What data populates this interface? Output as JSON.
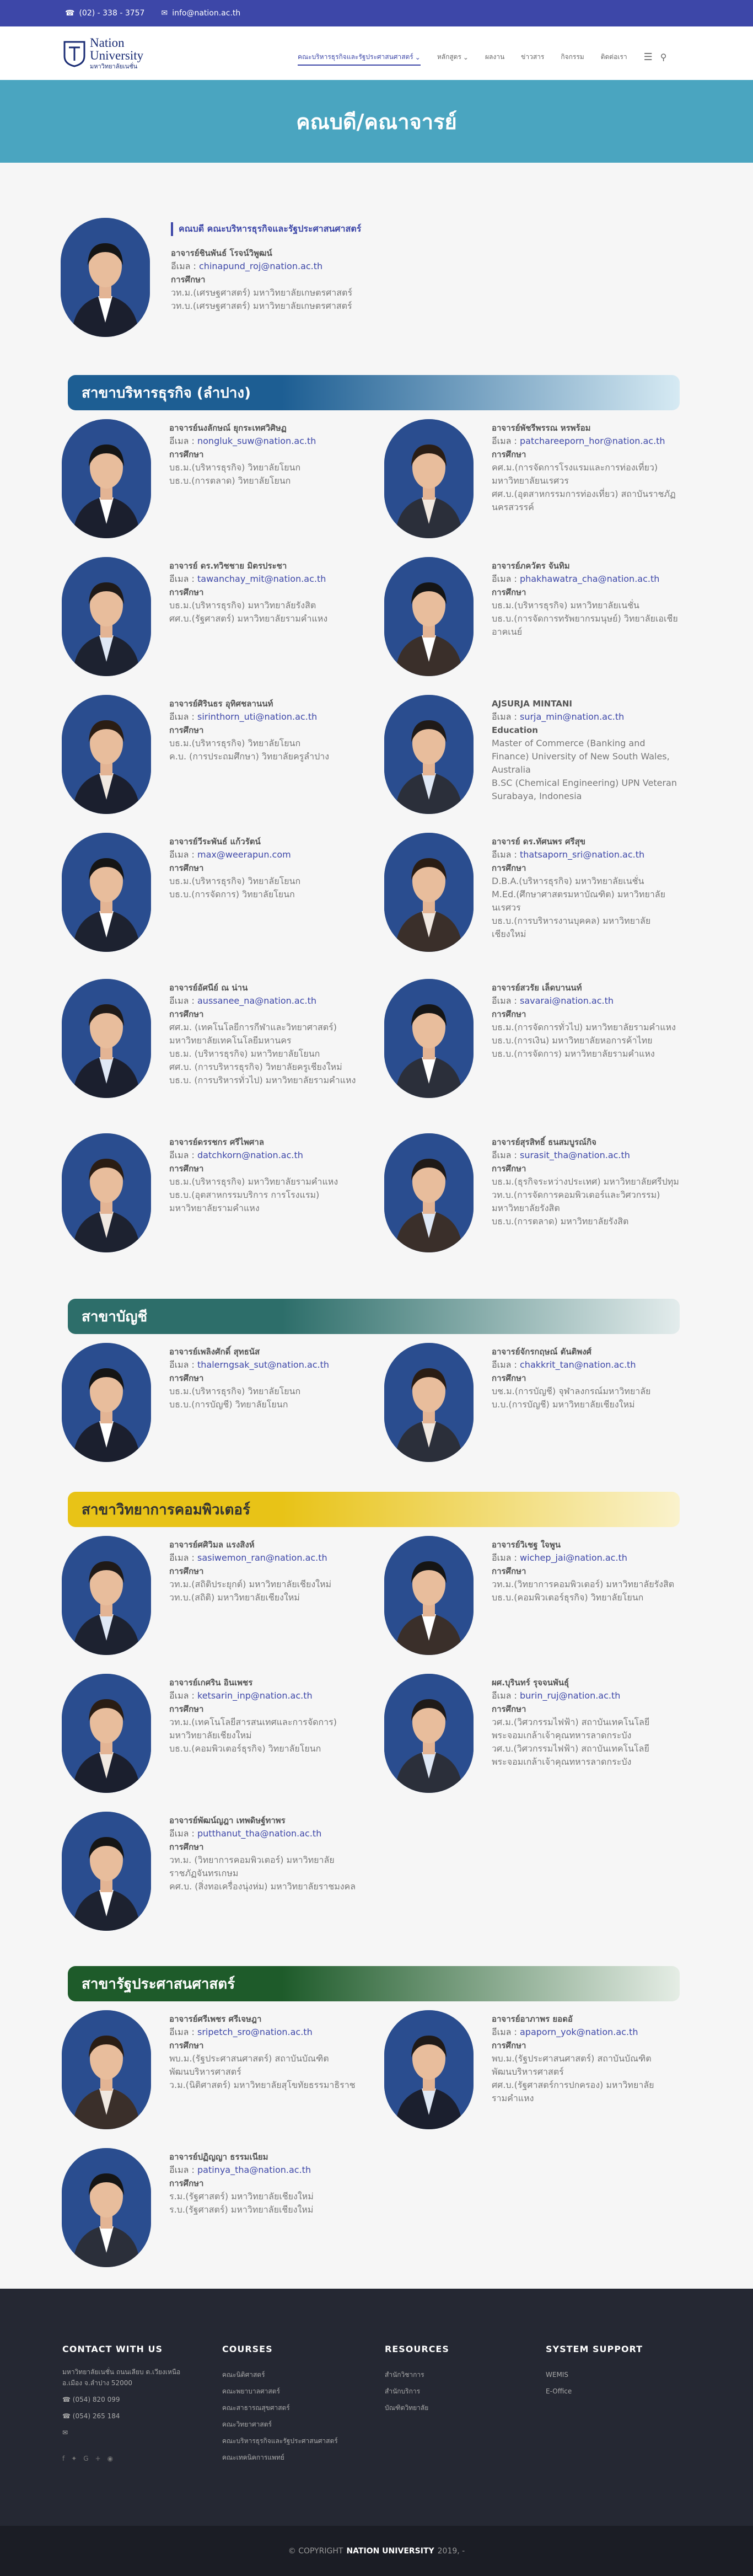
{
  "topbar": {
    "phone": "(02) - 338 - 3757",
    "email": "info@nation.ac.th"
  },
  "logo": {
    "line1": "Nation",
    "line2": "University",
    "line3": "มหาวิทยาลัยเนชั่น"
  },
  "nav": [
    "คณะบริหารธุรกิจและรัฐประศาสนศาสตร์",
    "หลักสูตร",
    "ผลงาน",
    "ข่าวสาร",
    "กิจกรรม",
    "ติดต่อเรา"
  ],
  "banner": {
    "title": "คณบดี/คณาจารย์"
  },
  "dean": {
    "title": "คณบดี คณะบริหารธุรกิจและรัฐประศาสนศาสตร์",
    "name": "อาจารย์ชินพันธ์ โรจน์วิพูฒน์",
    "email_label": "อีเมล :",
    "email": "chinapund_roj@nation.ac.th",
    "edu_label": "การศึกษา",
    "edu": [
      "วท.ม.(เศรษฐศาสตร์) มหาวิทยาลัยเกษตรศาสตร์",
      "วท.บ.(เศรษฐศาสตร์) มหาวิทยาลัยเกษตรศาสตร์"
    ]
  },
  "sections": [
    {
      "title": "สาขาบริหารธุรกิจ (ลำปาง)",
      "c1": "#1d5e93",
      "c2": "#d6eaf3",
      "people": [
        {
          "name": "อาจารย์นงลักษณ์ ยุกระเทศวิศิษฏ",
          "email": "nongluk_suw@nation.ac.th",
          "edu": [
            "บธ.ม.(บริหารธุรกิจ) วิทยาลัยโยนก",
            "บธ.บ.(การตลาด) วิทยาลัยโยนก"
          ]
        },
        {
          "name": "อาจารย์พัชรีพรรณ หรพร้อม",
          "email": "patchareeporn_hor@nation.ac.th",
          "edu": [
            "คศ.ม.(การจัดการโรงแรมและการท่องเที่ยว) มหาวิทยาลัยนเรศวร",
            "ศศ.บ.(อุตสาหกรรมการท่องเที่ยว) สถาบันราชภัฏนครสวรรค์"
          ]
        },
        {
          "name": "อาจารย์ ดร.ทวิชชาย มิตรประชา",
          "email": "tawanchay_mit@nation.ac.th",
          "edu": [
            "บธ.ม.(บริหารธุรกิจ) มหาวิทยาลัยรังสิต",
            "ศศ.บ.(รัฐศาสตร์) มหาวิทยาลัยรามคำแหง"
          ]
        },
        {
          "name": "อาจารย์ภควัตร จันทิม",
          "email": "phakhawatra_cha@nation.ac.th",
          "edu": [
            "บธ.ม.(บริหารธุรกิจ) มหาวิทยาลัยเนชั่น",
            "บธ.บ.(การจัดการทรัพยากรมนุษย์) วิทยาลัยเอเชียอาคเนย์"
          ]
        },
        {
          "name": "อาจารย์ศิรินธร อุทิศชลานนท์",
          "email": "sirinthorn_uti@nation.ac.th",
          "edu": [
            "บธ.ม.(บริหารธุรกิจ) วิทยาลัยโยนก",
            "ค.บ. (การประถมศึกษา) วิทยาลัยครูลำปาง"
          ]
        },
        {
          "name": "AJSURJA MINTANI",
          "email": "surja_min@nation.ac.th",
          "edu_label": "Education",
          "edu": [
            "Master of Commerce (Banking and Finance) University of New South Wales, Australia",
            "B.SC (Chemical Engineering) UPN Veteran Surabaya, Indonesia"
          ]
        },
        {
          "name": "อาจารย์วีระพันธ์ แก้วรัตน์",
          "email": "max@weerapun.com",
          "edu": [
            "บธ.ม.(บริหารธุรกิจ) วิทยาลัยโยนก",
            "บธ.บ.(การจัดการ) วิทยาลัยโยนก"
          ]
        },
        {
          "name": "อาจารย์ ดร.ทัศนพร ศรีสุข",
          "email": "thatsaporn_sri@nation.ac.th",
          "edu": [
            "D.B.A.(บริหารธุรกิจ) มหาวิทยาลัยเนชั่น",
            "M.Ed.(ศึกษาศาสตรมหาบัณฑิต) มหาวิทยาลัยนเรศวร",
            "บธ.บ.(การบริหารงานบุคคล) มหาวิทยาลัยเชียงใหม่"
          ]
        },
        {
          "name": "อาจารย์อัศนีย์ ณ น่าน",
          "email": "aussanee_na@nation.ac.th",
          "edu": [
            "ศศ.ม. (เทคโนโลยีการกีฬาและวิทยาศาสตร์) มหาวิทยาลัยเทคโนโลยีมหานคร",
            "บธ.ม. (บริหารธุรกิจ) มหาวิทยาลัยโยนก",
            "ศศ.บ. (การบริหารธุรกิจ) วิทยาลัยครูเชียงใหม่",
            "บธ.บ. (การบริหารทั่วไป) มหาวิทยาลัยรามคำแหง"
          ]
        },
        {
          "name": "อาจารย์สวรัย เล็ดบานนท์",
          "email": "savarai@nation.ac.th",
          "edu": [
            "บธ.ม.(การจัดการทั่วไป) มหาวิทยาลัยรามคำแหง",
            "บธ.บ.(การเงิน) มหาวิทยาลัยหอการค้าไทย",
            "บธ.บ.(การจัดการ) มหาวิทยาลัยรามคำแหง"
          ]
        },
        {
          "name": "อาจารย์ดรรชกร ศรีไพศาล",
          "email": "datchkorn@nation.ac.th",
          "edu": [
            "บธ.ม.(บริหารธุรกิจ) มหาวิทยาลัยรามคำแหง",
            "บธ.บ.(อุตสาหกรรมบริการ การโรงแรม) มหาวิทยาลัยรามคำแหง"
          ]
        },
        {
          "name": "อาจารย์สุรสิทธิ์ ธนสมบูรณ์กิจ",
          "email": "surasit_tha@nation.ac.th",
          "edu": [
            "บธ.ม.(ธุรกิจระหว่างประเทศ) มหาวิทยาลัยศรีปทุม",
            "วท.บ.(การจัดการคอมพิวเตอร์และวิศวกรรม) มหาวิทยาลัยรังสิต",
            "บธ.บ.(การตลาด) มหาวิทยาลัยรังสิต"
          ]
        }
      ]
    },
    {
      "title": "สาขาบัญชี",
      "c1": "#2d6e6a",
      "c2": "#e3ecec",
      "people": [
        {
          "name": "อาจารย์เพลิงศักดิ์ สุทธนัส",
          "email": "thalerngsak_sut@nation.ac.th",
          "edu": [
            "บธ.ม.(บริหารธุรกิจ) วิทยาลัยโยนก",
            "บธ.บ.(การบัญชี) วิทยาลัยโยนก"
          ]
        },
        {
          "name": "อาจารย์จักรกฤษณ์ ตันติพงศ์",
          "email": "chakkrit_tan@nation.ac.th",
          "edu": [
            "บช.ม.(การบัญชี) จุฬาลงกรณ์มหาวิทยาลัย",
            "บ.บ.(การบัญชี) มหาวิทยาลัยเชียงใหม่"
          ]
        }
      ]
    },
    {
      "title": "สาขาวิทยาการคอมพิวเตอร์",
      "c1": "#e8c317",
      "c2": "#faf2cc",
      "people": [
        {
          "name": "อาจารย์ศศิวิมล แรงสิงห์",
          "email": "sasiwemon_ran@nation.ac.th",
          "edu": [
            "วท.ม.(สถิติประยุกต์) มหาวิทยาลัยเชียงใหม่",
            "วท.บ.(สถิติ) มหาวิทยาลัยเชียงใหม่"
          ]
        },
        {
          "name": "อาจารย์วิเชฐ ใจพูน",
          "email": "wichep_jai@nation.ac.th",
          "edu": [
            "วท.ม.(วิทยาการคอมพิวเตอร์) มหาวิทยาลัยรังสิต",
            "บธ.บ.(คอมพิวเตอร์ธุรกิจ) วิทยาลัยโยนก"
          ]
        },
        {
          "name": "อาจารย์เกศริน อินเพชร",
          "email": "ketsarin_inp@nation.ac.th",
          "edu": [
            "วท.ม.(เทคโนโลยีสารสนเทศและการจัดการ) มหาวิทยาลัยเชียงใหม่",
            "บธ.บ.(คอมพิวเตอร์ธุรกิจ) วิทยาลัยโยนก"
          ]
        },
        {
          "name": "ผศ.บุรินทร์ รุจจนพันธุ์",
          "email": "burin_ruj@nation.ac.th",
          "edu": [
            "วศ.ม.(วิศวกรรมไฟฟ้า) สถาบันเทคโนโลยีพระจอมเกล้าเจ้าคุณทหารลาดกระบัง",
            "วศ.บ.(วิศวกรรมไฟฟ้า) สถาบันเทคโนโลยีพระจอมเกล้าเจ้าคุณทหารลาดกระบัง"
          ]
        },
        {
          "name": "อาจารย์พัฒน์ญฎา เทพดิษฐ์ทาพร",
          "email": "putthanut_tha@nation.ac.th",
          "edu": [
            "วท.ม. (วิทยาการคอมพิวเตอร์) มหาวิทยาลัยราชภัฏจันทรเกษม",
            "คศ.บ. (สิ่งทอเครื่องนุ่งห่ม) มหาวิทยาลัยราชมงคล"
          ]
        }
      ]
    },
    {
      "title": "สาขารัฐประศาสนศาสตร์",
      "c1": "#1e5b2a",
      "c2": "#e5ede5",
      "people": [
        {
          "name": "อาจารย์ศรีเพชร ศรีเจษฎา",
          "email": "sripetch_sro@nation.ac.th",
          "edu": [
            "พบ.ม.(รัฐประศาสนศาสตร์) สถาบันบัณฑิตพัฒนบริหารศาสตร์",
            "ว.ม.(นิติศาสตร์) มหาวิทยาลัยสุโขทัยธรรมาธิราช"
          ]
        },
        {
          "name": "อาจารย์อาภาพร ยอดอั",
          "email": "apaporn_yok@nation.ac.th",
          "edu": [
            "พบ.ม.(รัฐประศาสนศาสตร์) สถาบันบัณฑิตพัฒนบริหารศาสตร์",
            "ศศ.บ.(รัฐศาสตร์การปกครอง) มหาวิทยาลัยรามคำแหง"
          ]
        },
        {
          "name": "อาจารย์ปฏิญญา ธรรมเนียม",
          "email": "patinya_tha@nation.ac.th",
          "edu": [
            "ร.ม.(รัฐศาสตร์) มหาวิทยาลัยเชียงใหม่",
            "ร.บ.(รัฐศาสตร์) มหาวิทยาลัยเชียงใหม่"
          ]
        }
      ]
    }
  ],
  "labels": {
    "email": "อีเมล :",
    "edu": "การศึกษา"
  },
  "footer": {
    "contact_title": "CONTACT WITH US",
    "address": "มหาวิทยาลัยเนชั่น ถนนเลียบ ต.เวียงเหนือ อ.เมือง จ.ลำปาง 52000",
    "phone1": "(054) 820 099",
    "phone2": "(054) 265 184",
    "courses_title": "COURSES",
    "courses": [
      "คณะนิติศาสตร์",
      "คณะพยาบาลศาสตร์",
      "คณะสาธารณสุขศาสตร์",
      "คณะวิทยาศาสตร์",
      "คณะบริหารธุรกิจและรัฐประศาสนศาสตร์",
      "คณะเทคนิคการแพทย์"
    ],
    "resources_title": "RESOURCES",
    "resources": [
      "สำนักวิชาการ",
      "สำนักบริการ",
      "บัณฑิตวิทยาลัย"
    ],
    "support_title": "SYSTEM SUPPORT",
    "support": [
      "WEMIS",
      "E-Office"
    ]
  },
  "copyright": {
    "prefix": "© COPYRIGHT",
    "brand": "NATION UNIVERSITY",
    "suffix": "2019, -"
  }
}
